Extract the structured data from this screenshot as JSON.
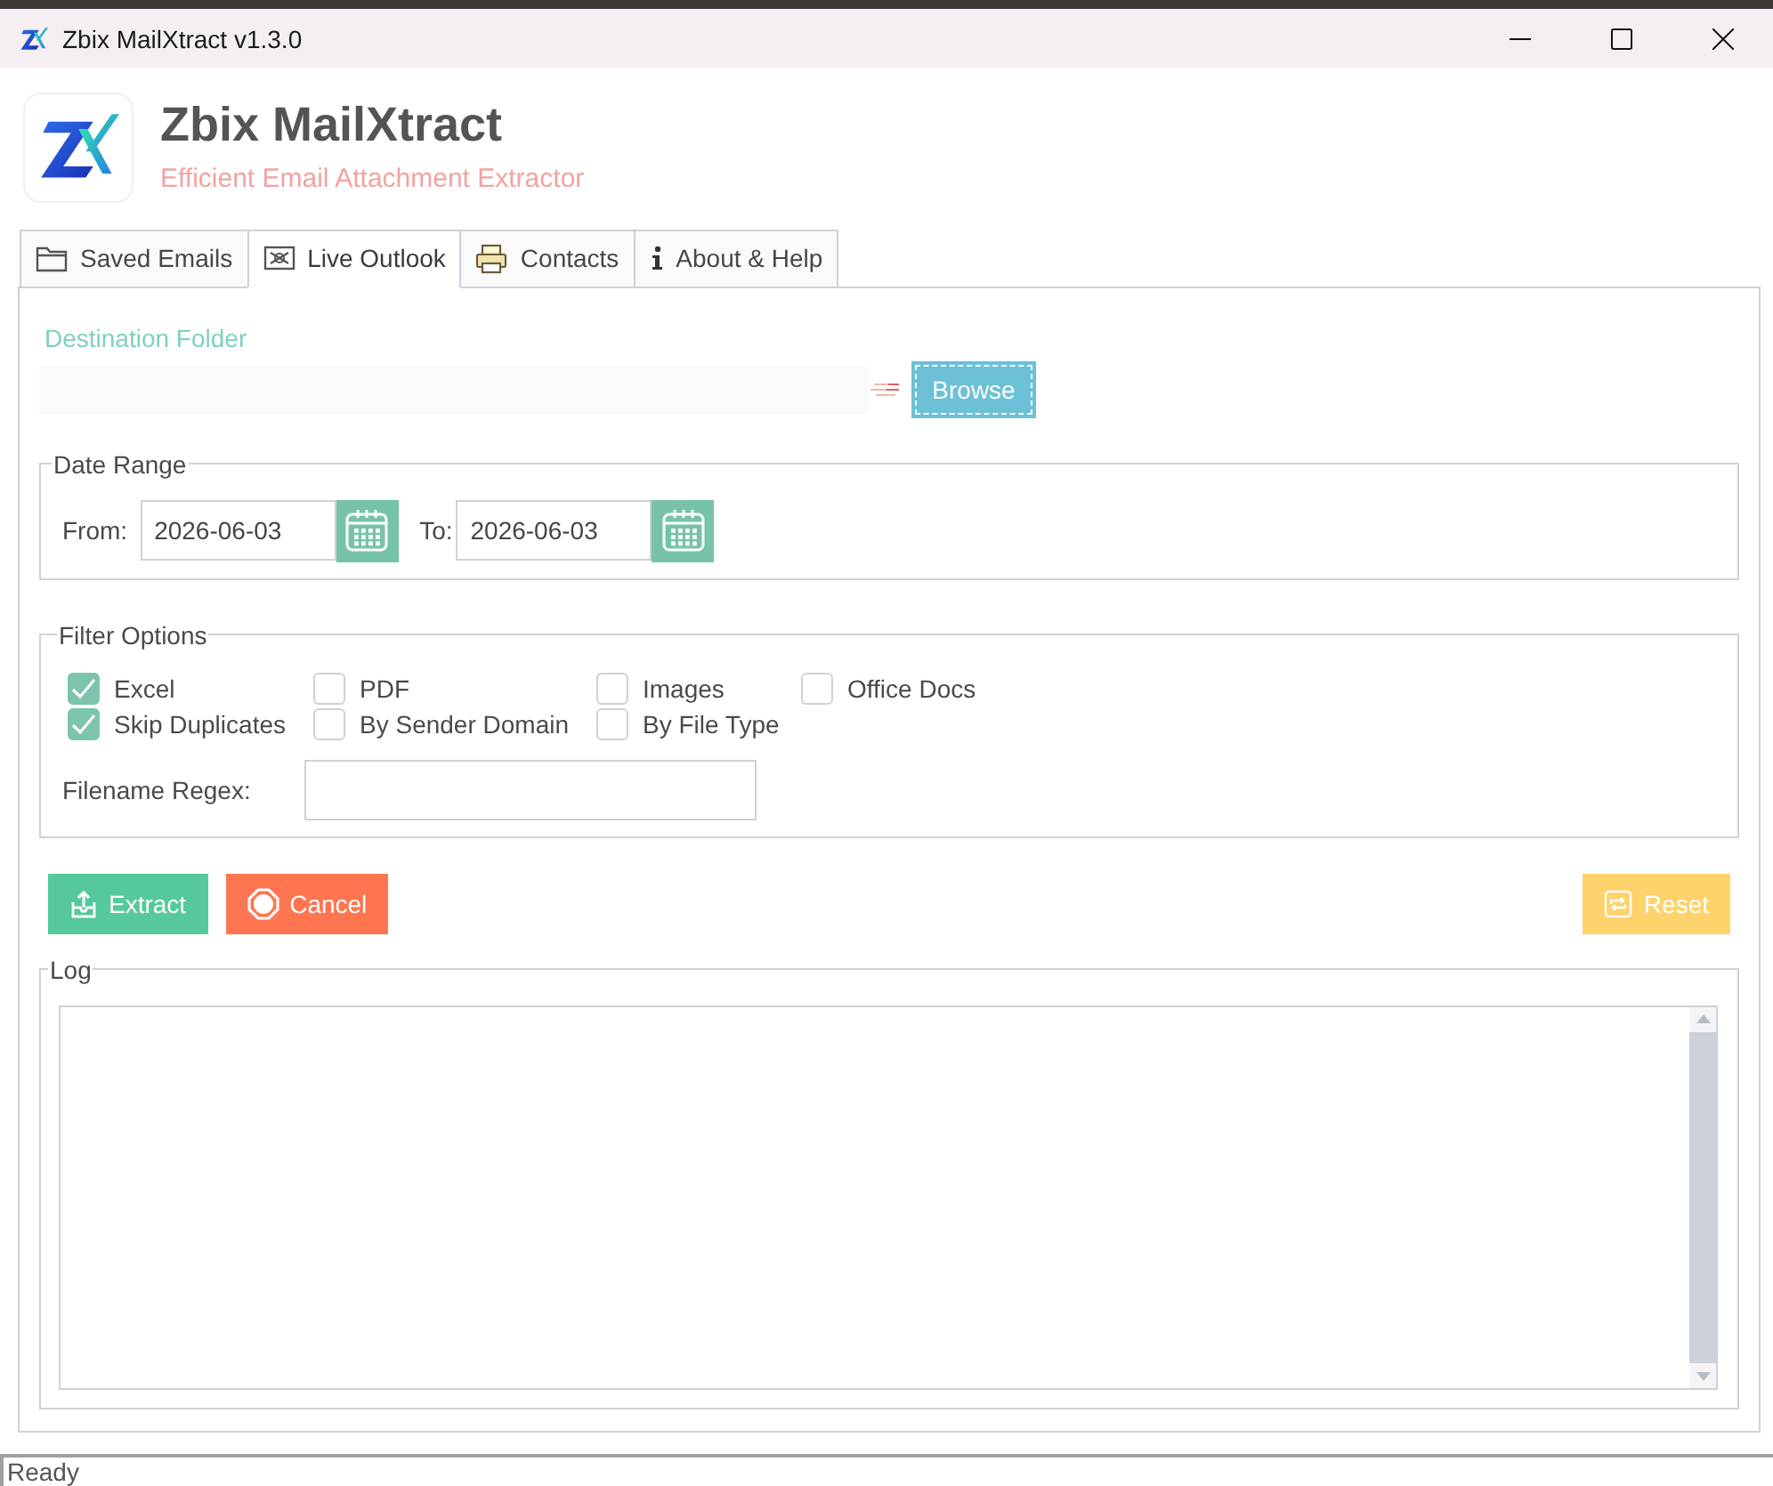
{
  "window": {
    "title": "Zbix MailXtract v1.3.0"
  },
  "header": {
    "title": "Zbix MailXtract",
    "subtitle": "Efficient Email Attachment Extractor"
  },
  "tabs": [
    {
      "label": "Saved Emails",
      "selected": false
    },
    {
      "label": "Live Outlook",
      "selected": true
    },
    {
      "label": "Contacts",
      "selected": false
    },
    {
      "label": "About & Help",
      "selected": false
    }
  ],
  "destination": {
    "label": "Destination Folder",
    "browse": {
      "label": "Browse",
      "focused": true
    }
  },
  "date_range": {
    "title": "Date Range",
    "from_label": "From:",
    "from_value": "2026-06-03",
    "to_label": "To:",
    "to_value": "2026-06-03"
  },
  "filter_options": {
    "title": "Filter Options",
    "checkboxes": [
      {
        "label": "Excel",
        "checked": true
      },
      {
        "label": "PDF",
        "checked": false
      },
      {
        "label": "Images",
        "checked": false
      },
      {
        "label": "Office Docs",
        "checked": false
      },
      {
        "label": "Skip Duplicates",
        "checked": true
      },
      {
        "label": "By Sender Domain",
        "checked": false
      },
      {
        "label": "By File Type",
        "checked": false
      }
    ],
    "regex_label": "Filename Regex:"
  },
  "actions": [
    {
      "label": "Extract",
      "kind": "extract"
    },
    {
      "label": "Cancel",
      "kind": "cancel"
    },
    {
      "label": "Reset",
      "kind": "reset"
    }
  ],
  "log": {
    "title": "Log"
  },
  "status_bar": {
    "text": "Ready"
  }
}
